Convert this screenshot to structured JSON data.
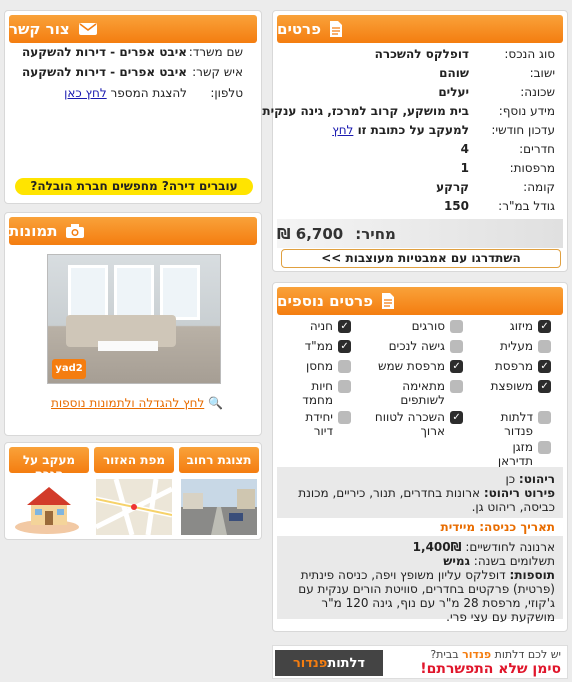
{
  "details": {
    "title": "פרטים",
    "rows": [
      {
        "label": "סוג הנכס:",
        "value": "דופלקס להשכרה"
      },
      {
        "label": "ישוב:",
        "value": "שוהם"
      },
      {
        "label": "שכונה:",
        "value": "יעלים"
      },
      {
        "label": "מידע נוסף:",
        "value": "בית מושקע, קרוב למרכז, גינה ענקית"
      },
      {
        "label": "עדכון חודשי:",
        "value": "למעקב על כתובת זו",
        "link": "לחץ"
      },
      {
        "label": "חדרים:",
        "value": "4"
      },
      {
        "label": "מרפסות:",
        "value": "1"
      },
      {
        "label": "קומה:",
        "value": "קרקע"
      },
      {
        "label": "גודל במ\"ר:",
        "value": "150"
      }
    ],
    "price_label": "מחיר:",
    "price_value": "6,700 ₪",
    "compare_button": "השתדרגו עם אמבטיות מעוצבות >>"
  },
  "contact": {
    "title": "צור קשר",
    "rows": [
      {
        "label": "שם משרד:",
        "value": "איבט אפרים - דירות להשקעה"
      },
      {
        "label": "איש קשר:",
        "value": "איבט אפרים - דירות להשקעה"
      }
    ],
    "phone_label": "טלפון:",
    "phone_text": "להצגת המספר",
    "phone_link": "לחץ כאן",
    "moving_button": "עוברים דירה? מחפשים חברת הובלה?"
  },
  "photos": {
    "title": "תמונות",
    "logo_text": "yad2",
    "enlarge_link": "לחץ להגדלה ולתמונות נוספות"
  },
  "extras": {
    "title": "פרטים נוספים",
    "features": [
      {
        "label": "מיזוג",
        "checked": true
      },
      {
        "label": "סורגים",
        "checked": false
      },
      {
        "label": "חניה",
        "checked": true
      },
      {
        "label": "מעלית",
        "checked": false
      },
      {
        "label": "גישה לנכים",
        "checked": false
      },
      {
        "label": "ממ\"ד",
        "checked": true
      },
      {
        "label": "מרפסת",
        "checked": true
      },
      {
        "label": "מרפסת שמש",
        "checked": true
      },
      {
        "label": "מחסן",
        "checked": false
      },
      {
        "label": "משופצת",
        "checked": true
      },
      {
        "label": "מתאימה לשותפים",
        "checked": false
      },
      {
        "label": "חיות מחמד",
        "checked": false
      },
      {
        "label": "דלתות פנדור",
        "checked": false
      },
      {
        "label": "השכרה לטווח ארוך",
        "checked": true
      },
      {
        "label": "יחידת דיור",
        "checked": false
      },
      {
        "label": "מזגן תדיראן",
        "checked": false
      }
    ],
    "furniture_label": "ריהוט:",
    "furniture_value": "כן",
    "furniture_detail_label": "פירוט ריהוט:",
    "furniture_detail_value": "ארונות בחדרים, תנור, כיריים, מכונת כביסה, ריהוט גן.",
    "entry_date": "תאריך כניסה: מיידית",
    "arnona_label": "ארנונה לחודשיים:",
    "arnona_value": "1,400₪",
    "payments_label": "תשלומים בשנה:",
    "payments_value": "גמיש",
    "additions_label": "תוספות:",
    "additions_value": "דופלקס עליון משופץ ויפה, כניסה פינתית (פרטית) פרקטים בחדרים, סוויטת הורים ענקית עם ג'קוזי, מרפסת 28 מ\"ר עם נוף, גינה 120 מ\"ר מושקעת עם עצי פרי."
  },
  "maps": {
    "tabs": [
      "תצוגת רחוב",
      "מפת האזור",
      "מעקב על הנכס"
    ]
  },
  "banner": {
    "line1_prefix": "יש לכם דלתות",
    "line1_brand": "פנדור",
    "line1_suffix": "בבית?",
    "line2": "סימן שלא התפשרתם!",
    "logo_prefix": "דלתות",
    "logo_brand": "פנדור"
  },
  "colors": {
    "accent": "#f47d10",
    "link": "#1a1ab0",
    "yellow": "#ffe400"
  }
}
